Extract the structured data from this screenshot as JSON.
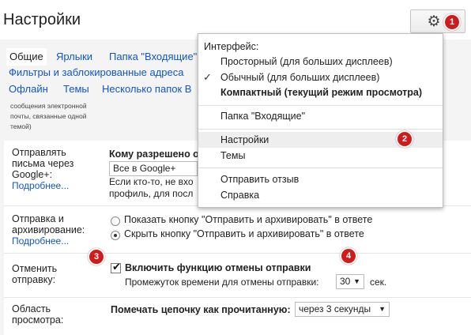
{
  "header": {
    "title": "Настройки"
  },
  "badges": [
    "1",
    "2",
    "3",
    "4"
  ],
  "tabs_row1": [
    {
      "label": "Общие",
      "active": true
    },
    {
      "label": "Ярлыки"
    },
    {
      "label": "Папка \"Входящие\""
    }
  ],
  "tabs_row2": [
    {
      "label": "Фильтры и заблокированные адреса"
    }
  ],
  "tabs_row3": [
    {
      "label": "Офлайн"
    },
    {
      "label": "Темы"
    },
    {
      "label": "Несколько папок В"
    }
  ],
  "small_note": "сообщения электронной почты, связанные одной темой)",
  "settings": {
    "google_plus": {
      "label": "Отправлять письма через Google+:",
      "more": "Подробнее...",
      "heading": "Кому разрешено о",
      "select_value": "Все в Google+",
      "desc_line1": "Если кто-то, не вхо",
      "desc_line2": "профиль, для посл"
    },
    "archive": {
      "label": "Отправка и архивирование:",
      "more": "Подробнее...",
      "option_show": "Показать кнопку \"Отправить и архивировать\" в ответе",
      "option_hide": "Скрыть кнопку \"Отправить и архивировать\" в ответе"
    },
    "undo": {
      "label": "Отменить отправку:",
      "checkbox_label": "Включить функцию отмены отправки",
      "period_label": "Промежуток времени для отмены отправки:",
      "period_value": "30",
      "period_unit": "сек."
    },
    "preview": {
      "label": "Область просмотра:",
      "mark_label": "Помечать цепочку как прочитанную:",
      "mark_value": "через 3 секунды"
    }
  },
  "menu": {
    "header": "Интерфейс:",
    "density": [
      {
        "label": "Просторный (для больших дисплеев)"
      },
      {
        "label": "Обычный (для больших дисплеев)",
        "checked": true
      },
      {
        "label": "Компактный (текущий режим просмотра)",
        "bold": true
      }
    ],
    "inbox": "Папка \"Входящие\"",
    "settings": "Настройки",
    "themes": "Темы",
    "feedback": "Отправить отзыв",
    "help": "Справка"
  },
  "colors": {
    "badge": "#cf1b1b",
    "link": "#1155cc"
  }
}
